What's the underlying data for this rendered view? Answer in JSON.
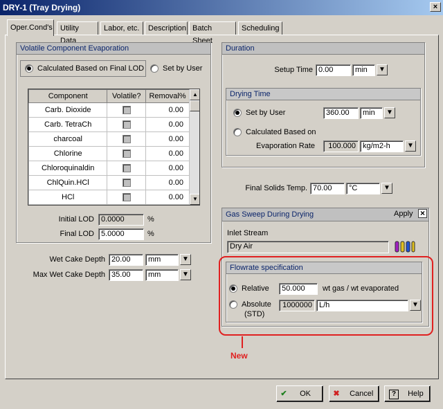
{
  "window": {
    "title": "DRY-1 (Tray Drying)",
    "close": "×"
  },
  "tabs": [
    "Oper.Cond's",
    "Utility Data",
    "Labor, etc.",
    "Description",
    "Batch Sheet",
    "Scheduling"
  ],
  "volatile": {
    "title": "Volatile Component Evaporation",
    "opt_calc": "Calculated Based on Final LOD",
    "opt_user": "Set by User",
    "headers": [
      "Component",
      "Volatile?",
      "Removal%"
    ],
    "rows": [
      {
        "component": "Carb. Dioxide",
        "removal": "0.00"
      },
      {
        "component": "Carb. TetraCh",
        "removal": "0.00"
      },
      {
        "component": "charcoal",
        "removal": "0.00"
      },
      {
        "component": "Chlorine",
        "removal": "0.00"
      },
      {
        "component": "Chloroquinaldin",
        "removal": "0.00"
      },
      {
        "component": "ChlQuin.HCl",
        "removal": "0.00"
      },
      {
        "component": "HCl",
        "removal": "0.00"
      }
    ],
    "initial_lod_label": "Initial LOD",
    "initial_lod": "0.0000",
    "final_lod_label": "Final LOD",
    "final_lod": "5.0000",
    "pct": "%"
  },
  "cake": {
    "wet_label": "Wet Cake Depth",
    "wet_value": "20.00",
    "wet_unit": "mm",
    "max_label": "Max Wet Cake Depth",
    "max_value": "35.00",
    "max_unit": "mm"
  },
  "duration": {
    "title": "Duration",
    "setup_label": "Setup Time",
    "setup_value": "0.00",
    "setup_unit": "min",
    "drying_title": "Drying Time",
    "set_user": "Set by User",
    "user_value": "360.00",
    "user_unit": "min",
    "calc_line1": "Calculated Based on",
    "calc_line2": "Evaporation Rate",
    "rate_value": "100.000",
    "rate_unit": "kg/m2-h"
  },
  "final_temp": {
    "label": "Final Solids Temp.",
    "value": "70.00",
    "unit": "°C"
  },
  "gas": {
    "title": "Gas Sweep During Drying",
    "apply": "Apply",
    "apply_mark": "×",
    "inlet_label": "Inlet Stream",
    "inlet_value": "Dry Air",
    "flow_title": "Flowrate specification",
    "relative": "Relative",
    "relative_value": "50.000",
    "relative_unit": "wt gas / wt evaporated",
    "absolute": "Absolute",
    "std": "(STD)",
    "absolute_value": "1000000",
    "absolute_unit": "L/h"
  },
  "annotation": "New",
  "buttons": {
    "ok": "OK",
    "cancel": "Cancel",
    "help": "Help"
  },
  "icons": {
    "dropdown": "▼",
    "check": "✔",
    "cancel": "✖",
    "help": "?",
    "up": "▲",
    "down": "▼"
  }
}
